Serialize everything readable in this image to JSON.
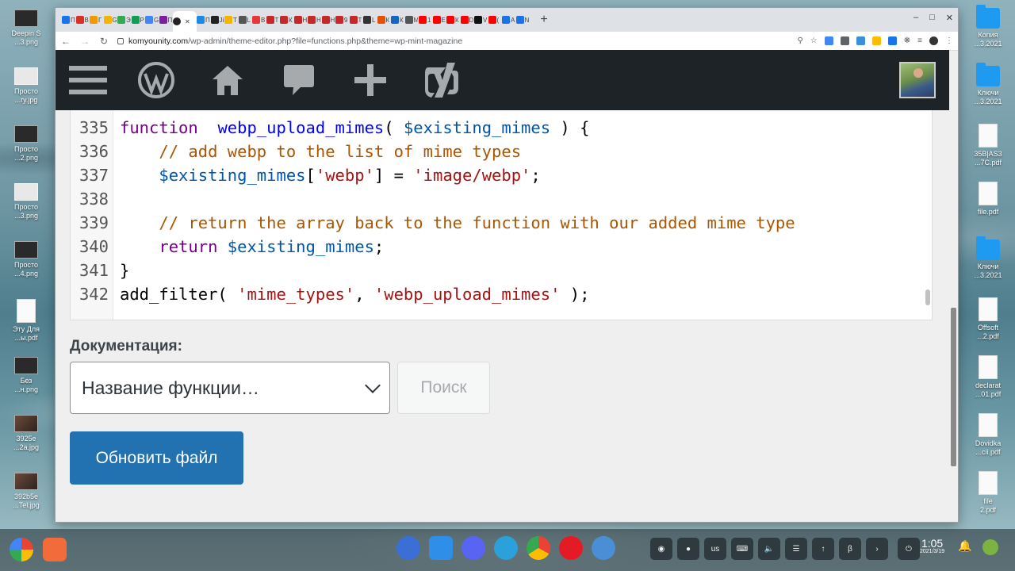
{
  "desktop": {
    "left_icons": [
      {
        "label": "Deepin S\n...3.png",
        "kind": "dark"
      },
      {
        "label": "Просто\n...ry.jpg",
        "kind": "light"
      },
      {
        "label": "Просто\n...2.png",
        "kind": "dark"
      },
      {
        "label": "Просто\n...3.png",
        "kind": "light"
      },
      {
        "label": "Просто\n...4.png",
        "kind": "dark"
      },
      {
        "label": "Эту Для\n...ы.pdf",
        "kind": "pdf"
      },
      {
        "label": "Без\n...н.png",
        "kind": "dark"
      },
      {
        "label": "3925e\n...2a.jpg",
        "kind": "photo"
      },
      {
        "label": "392b5e\n...Tel.jpg",
        "kind": "photo"
      }
    ],
    "right_icons": [
      {
        "label": "Копия\n...3.2021",
        "kind": "folder"
      },
      {
        "label": "Ключи\n...3.2021",
        "kind": "folder"
      },
      {
        "label": "35B|AS3\n...7C.pdf",
        "kind": "pdf"
      },
      {
        "label": "file.pdf",
        "kind": "pdf"
      },
      {
        "label": "Ключи\n...3.2021",
        "kind": "folder"
      },
      {
        "label": "Offsoft\n...2.pdf",
        "kind": "pdf"
      },
      {
        "label": "declarat\n...01.pdf",
        "kind": "pdf"
      },
      {
        "label": "Dovidka\n...cii.pdf",
        "kind": "pdf"
      },
      {
        "label": "file\n2.pdf",
        "kind": "pdf"
      }
    ]
  },
  "browser": {
    "tabs": [
      {
        "label": "П",
        "color": "#1a73e8"
      },
      {
        "label": "В",
        "color": "#d93025"
      },
      {
        "label": "Г",
        "color": "#f29900"
      },
      {
        "label": "G",
        "color": "#f4b400"
      },
      {
        "label": "Э",
        "color": "#34a853"
      },
      {
        "label": "Р",
        "color": "#0f9d58"
      },
      {
        "label": "G",
        "color": "#4285f4"
      },
      {
        "label": "П",
        "color": "#7b1fa2"
      },
      {
        "label": "П",
        "color": "#1e88e5"
      },
      {
        "label": "Ji",
        "color": "#202124"
      },
      {
        "label": "Т",
        "color": "#f4b400"
      },
      {
        "label": "L",
        "color": "#555"
      },
      {
        "label": "В",
        "color": "#e53935"
      },
      {
        "label": "Т",
        "color": "#c62828"
      },
      {
        "label": "К",
        "color": "#c62828"
      },
      {
        "label": "Н",
        "color": "#c62828"
      },
      {
        "label": "Н",
        "color": "#c62828"
      },
      {
        "label": "Н",
        "color": "#c62828"
      },
      {
        "label": "9",
        "color": "#c62828"
      },
      {
        "label": "Т",
        "color": "#c62828"
      },
      {
        "label": "L",
        "color": "#333"
      },
      {
        "label": "К",
        "color": "#e65100"
      },
      {
        "label": "К",
        "color": "#1565c0"
      },
      {
        "label": "М",
        "color": "#555"
      },
      {
        "label": "1",
        "color": "#ff0000"
      },
      {
        "label": "Е",
        "color": "#ff0000"
      },
      {
        "label": "К",
        "color": "#ff0000"
      },
      {
        "label": "D",
        "color": "#ff0000"
      },
      {
        "label": "V",
        "color": "#111"
      },
      {
        "label": "(",
        "color": "#ff0000"
      },
      {
        "label": "A",
        "color": "#1a73e8"
      },
      {
        "label": "N",
        "color": "#1a73e8"
      }
    ],
    "active_tab_label": "Х",
    "new_tab": "+",
    "win_controls": [
      "–",
      "□",
      "✕"
    ],
    "url_host": "komyounity.com",
    "url_path": "/wp-admin/theme-editor.php?file=functions.php&theme=wp-mint-magazine"
  },
  "adminbar": {
    "items": [
      "menu-icon",
      "wordpress-icon",
      "home-icon",
      "comments-icon",
      "new-content-icon",
      "yoast-icon"
    ]
  },
  "editor": {
    "lines": [
      {
        "num": "335",
        "tokens": [
          [
            "kw",
            "function"
          ],
          [
            "",
            "  "
          ],
          [
            "def",
            "webp_upload_mimes"
          ],
          [
            "",
            "( "
          ],
          [
            "var",
            "$existing_mimes"
          ],
          [
            "",
            " ) {"
          ]
        ]
      },
      {
        "num": "336",
        "tokens": [
          [
            "",
            "    "
          ],
          [
            "cmt",
            "// add webp to the list of mime types"
          ]
        ]
      },
      {
        "num": "337",
        "tokens": [
          [
            "",
            "    "
          ],
          [
            "var",
            "$existing_mimes"
          ],
          [
            "",
            "["
          ],
          [
            "str",
            "'webp'"
          ],
          [
            "",
            "] = "
          ],
          [
            "str",
            "'image/webp'"
          ],
          [
            "",
            ";"
          ]
        ]
      },
      {
        "num": "338",
        "tokens": []
      },
      {
        "num": "339",
        "tokens": [
          [
            "",
            "    "
          ],
          [
            "cmt",
            "// return the array back to the function with our added mime type"
          ]
        ]
      },
      {
        "num": "340",
        "tokens": [
          [
            "",
            "    "
          ],
          [
            "kw",
            "return"
          ],
          [
            "",
            " "
          ],
          [
            "var",
            "$existing_mimes"
          ],
          [
            "",
            ";"
          ]
        ]
      },
      {
        "num": "341",
        "tokens": [
          [
            "",
            "}"
          ]
        ]
      },
      {
        "num": "342",
        "tokens": [
          [
            "",
            "add_filter( "
          ],
          [
            "str",
            "'mime_types'"
          ],
          [
            "",
            ", "
          ],
          [
            "str",
            "'webp_upload_mimes'"
          ],
          [
            "",
            " );"
          ]
        ]
      }
    ]
  },
  "docs": {
    "label": "Документация:",
    "select_value": "Название функции…",
    "search_button": "Поиск",
    "update_button": "Обновить файл"
  },
  "taskbar": {
    "tray": [
      "discord",
      "screen-recorder",
      "us",
      "keyboard",
      "volume",
      "wifi",
      "usb",
      "bluetooth",
      "›"
    ],
    "tray_labels": {
      "lang": "us"
    },
    "time": "1:05",
    "date": "2021/3/19"
  }
}
